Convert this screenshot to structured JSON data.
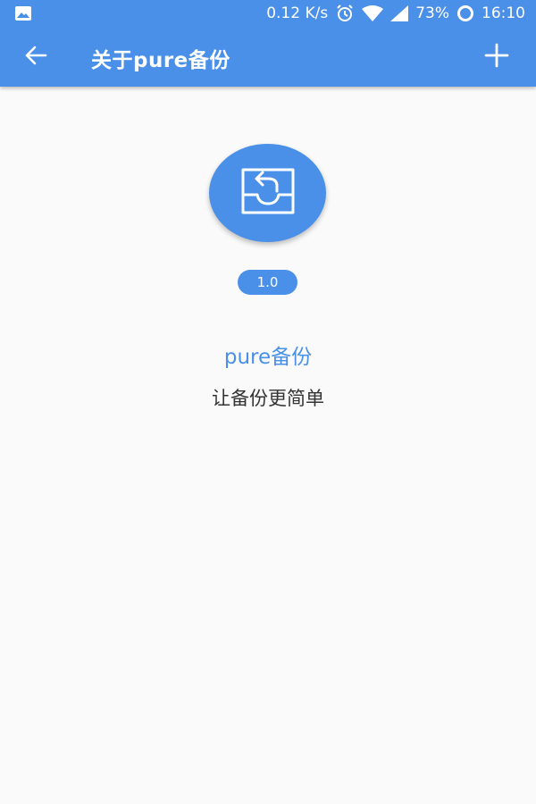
{
  "status_bar": {
    "left_icon": "image-icon",
    "net_speed": "0.12 K/s",
    "icons": [
      "alarm-icon",
      "wifi-icon",
      "signal-icon"
    ],
    "battery": "73%",
    "battery_icon": "battery-ring-icon",
    "time": "16:10"
  },
  "toolbar": {
    "back_icon": "arrow-left-icon",
    "title": "关于pure备份",
    "add_icon": "plus-icon"
  },
  "about": {
    "logo_icon": "inbox-restore-icon",
    "version": "1.0",
    "app_name": "pure备份",
    "slogan": "让备份更简单"
  },
  "colors": {
    "primary": "#4a90e8",
    "background": "#fafafa",
    "slogan_text": "#333333"
  }
}
